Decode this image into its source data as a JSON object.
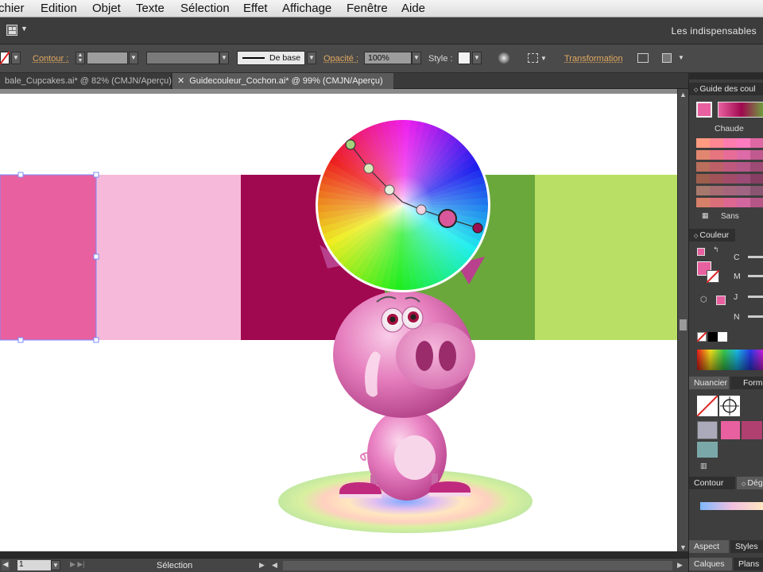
{
  "menu": [
    "chier",
    "Edition",
    "Objet",
    "Texte",
    "Sélection",
    "Effet",
    "Affichage",
    "Fenêtre",
    "Aide"
  ],
  "appbar": {
    "workspace": "Les indispensables"
  },
  "control": {
    "stroke_label": "Contour :",
    "stroke_style": "De base",
    "opacity_label": "Opacité :",
    "opacity_value": "100%",
    "style_label": "Style :",
    "transform_label": "Transformation"
  },
  "tabs": [
    {
      "label": "bale_Cupcakes.ai* @ 82% (CMJN/Aperçu)",
      "active": false
    },
    {
      "label": "Guidecouleur_Cochon.ai* @ 99% (CMJN/Aperçu)",
      "active": true
    }
  ],
  "colors": {
    "swatches": [
      "#e8609f",
      "#f6b9d9",
      "#a0084f",
      "#6aa83c",
      "#b9e064"
    ],
    "accent_pink": "#d9579a"
  },
  "status": {
    "page": "1",
    "tool": "Sélection"
  },
  "panels": {
    "guide_title": "Guide des coul",
    "guide_group": "Chaude",
    "guide_none": "Sans",
    "color_title": "Couleur",
    "color_channels": [
      "C",
      "M",
      "J",
      "N"
    ],
    "swatches_tab": "Nuancier",
    "forms_tab": "Form",
    "stroke_tab": "Contour",
    "gradient_tab": "Dég",
    "aspect_tab": "Aspect",
    "styles_tab": "Styles",
    "layers_tab": "Calques",
    "artboards_tab": "Plans"
  }
}
